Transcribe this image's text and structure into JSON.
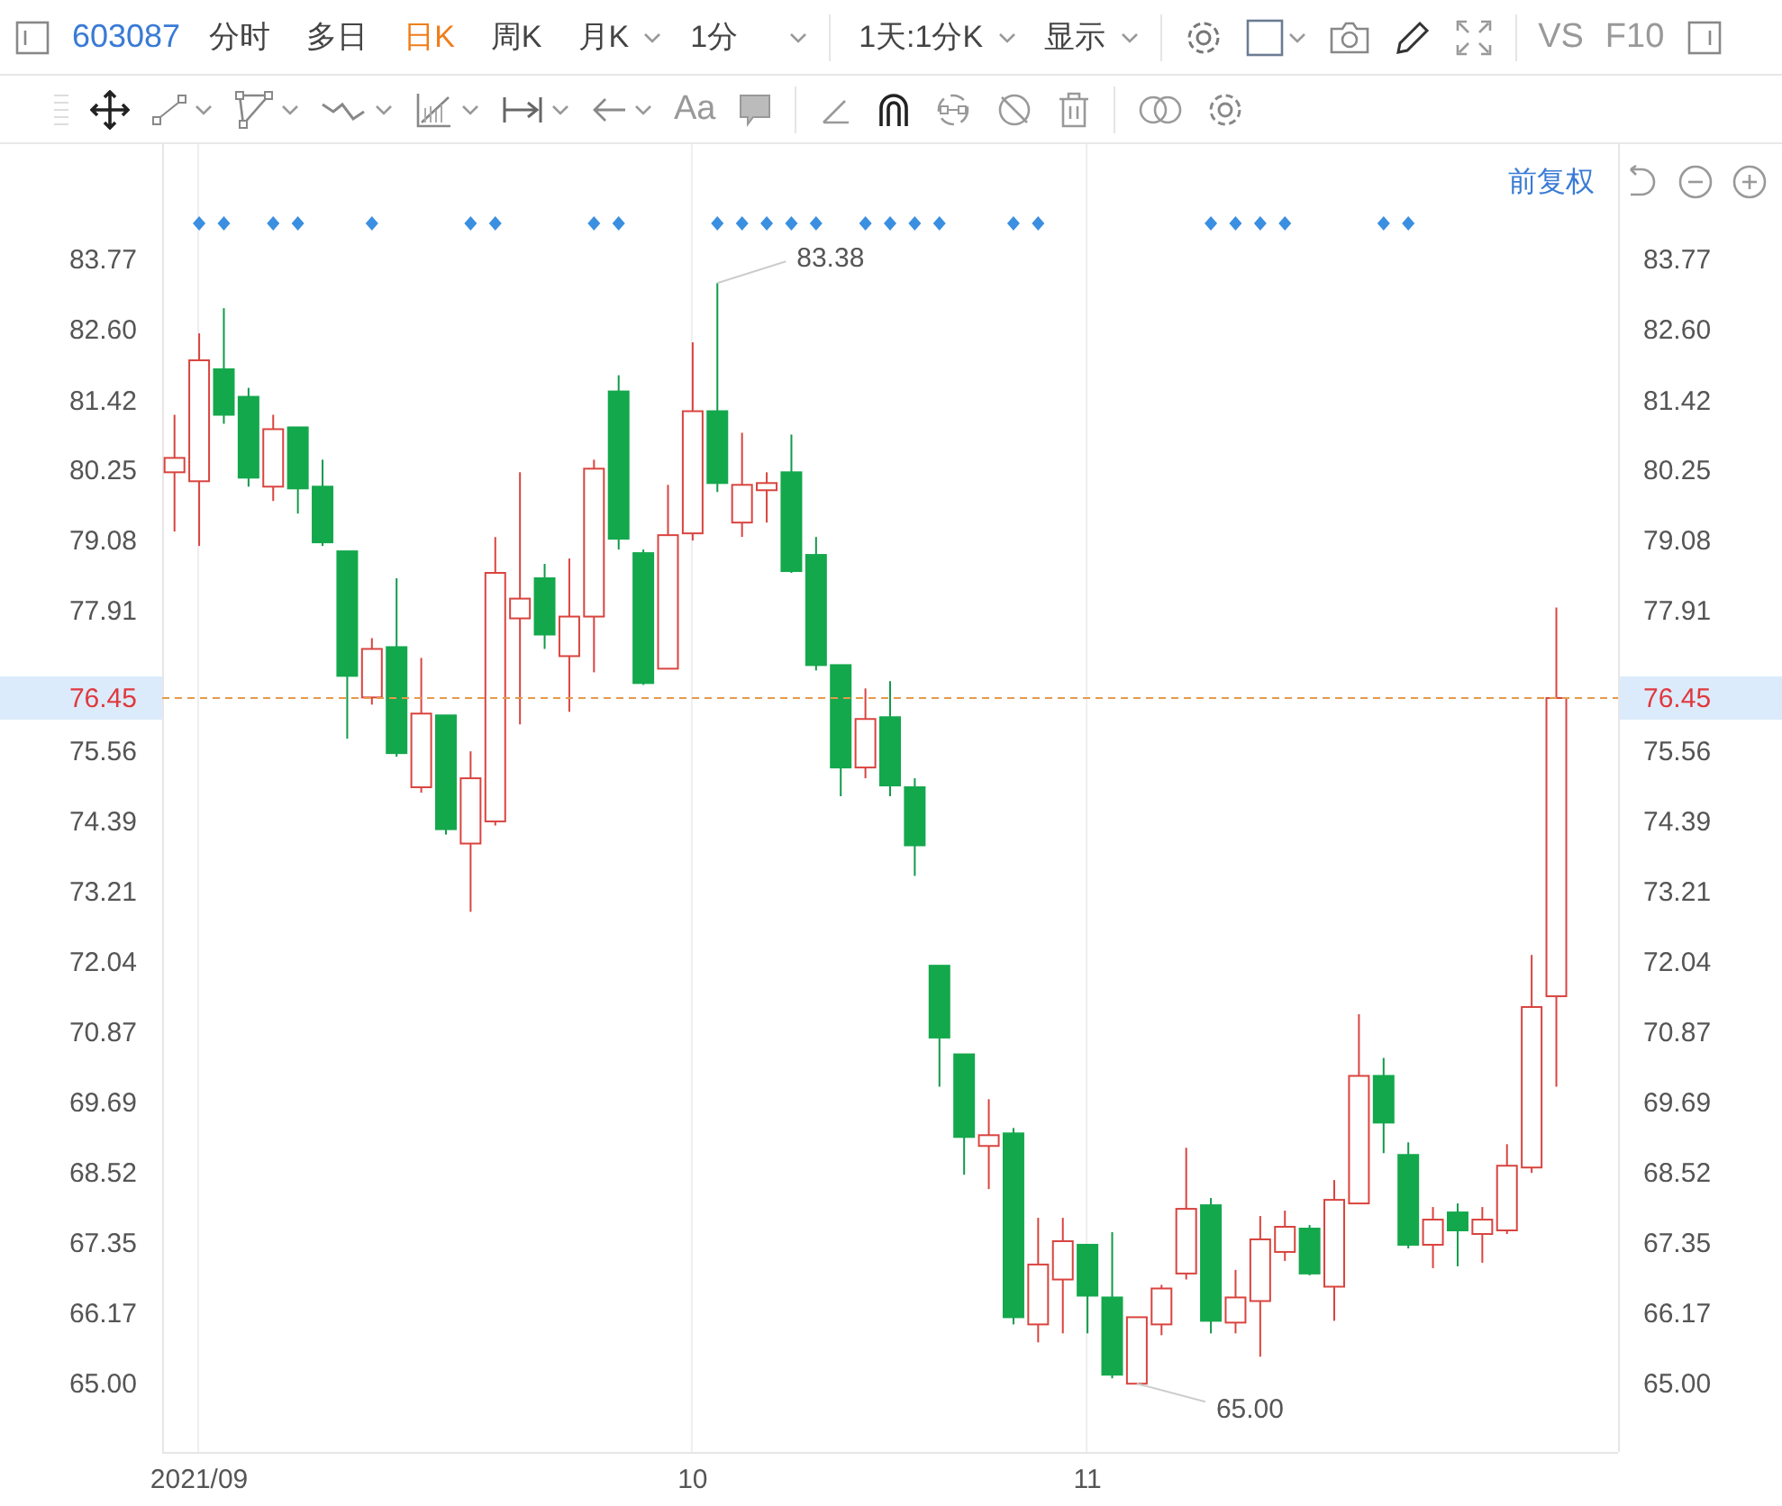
{
  "toolbar": {
    "symbol": "603087",
    "periods": [
      {
        "label": "分时",
        "selected": false,
        "dropdown": false
      },
      {
        "label": "多日",
        "selected": false,
        "dropdown": false
      },
      {
        "label": "日K",
        "selected": true,
        "dropdown": false
      },
      {
        "label": "周K",
        "selected": false,
        "dropdown": false
      },
      {
        "label": "月K",
        "selected": false,
        "dropdown": true
      },
      {
        "label": "1分",
        "selected": false,
        "dropdown": true
      }
    ],
    "range": "1天:1分K",
    "display": "显示",
    "compare": "VS",
    "f10": "F10"
  },
  "drawing_toolbar": {
    "text_tool": "Aa"
  },
  "chart": {
    "adjust": "前复权",
    "chart_data": {
      "type": "candlestick",
      "ylim": [
        63.86,
        85.7
      ],
      "yticks": [
        {
          "value": 83.77,
          "label": "83.77"
        },
        {
          "value": 82.6,
          "label": "82.60"
        },
        {
          "value": 81.42,
          "label": "81.42"
        },
        {
          "value": 80.25,
          "label": "80.25"
        },
        {
          "value": 79.08,
          "label": "79.08"
        },
        {
          "value": 77.91,
          "label": "77.91"
        },
        {
          "value": 75.56,
          "label": "75.56"
        },
        {
          "value": 74.39,
          "label": "74.39"
        },
        {
          "value": 73.21,
          "label": "73.21"
        },
        {
          "value": 72.04,
          "label": "72.04"
        },
        {
          "value": 70.87,
          "label": "70.87"
        },
        {
          "value": 69.69,
          "label": "69.69"
        },
        {
          "value": 68.52,
          "label": "68.52"
        },
        {
          "value": 67.35,
          "label": "67.35"
        },
        {
          "value": 66.17,
          "label": "66.17"
        },
        {
          "value": 65.0,
          "label": "65.00"
        }
      ],
      "categories": [
        null,
        "2021/09",
        null,
        null,
        null,
        null,
        null,
        null,
        null,
        null,
        null,
        null,
        null,
        null,
        null,
        null,
        null,
        null,
        null,
        null,
        null,
        "10",
        null,
        null,
        null,
        null,
        null,
        null,
        null,
        null,
        null,
        null,
        null,
        null,
        null,
        null,
        null,
        "11",
        null,
        null,
        null,
        null,
        null,
        null,
        null,
        null,
        null,
        null,
        null,
        null,
        null,
        null,
        null,
        null,
        null,
        null,
        null,
        null,
        null
      ],
      "ohlc": [
        [
          80.22,
          81.18,
          79.23,
          80.46
        ],
        [
          80.07,
          82.54,
          78.99,
          82.09
        ],
        [
          81.94,
          82.96,
          81.03,
          81.18
        ],
        [
          81.48,
          81.63,
          79.98,
          80.13
        ],
        [
          79.98,
          81.18,
          79.74,
          80.94
        ],
        [
          80.97,
          80.97,
          79.53,
          79.95
        ],
        [
          79.98,
          80.43,
          78.99,
          79.05
        ],
        [
          78.9,
          78.9,
          75.77,
          76.82
        ],
        [
          76.46,
          77.45,
          76.34,
          77.27
        ],
        [
          77.3,
          78.45,
          75.47,
          75.53
        ],
        [
          74.96,
          77.12,
          74.87,
          76.19
        ],
        [
          76.16,
          76.16,
          74.17,
          74.26
        ],
        [
          74.02,
          75.56,
          72.88,
          75.11
        ],
        [
          74.39,
          79.14,
          74.32,
          78.54
        ],
        [
          77.78,
          80.22,
          76.01,
          78.11
        ],
        [
          78.45,
          78.69,
          77.27,
          77.51
        ],
        [
          77.15,
          78.78,
          76.22,
          77.81
        ],
        [
          77.81,
          80.43,
          76.88,
          80.28
        ],
        [
          81.57,
          81.84,
          78.93,
          79.11
        ],
        [
          78.87,
          78.93,
          76.67,
          76.7
        ],
        [
          76.94,
          80.01,
          76.94,
          79.17
        ],
        [
          79.2,
          82.39,
          79.08,
          81.24
        ],
        [
          81.24,
          83.38,
          79.89,
          80.04
        ],
        [
          79.38,
          80.88,
          79.14,
          80.01
        ],
        [
          79.92,
          80.22,
          79.38,
          80.04
        ],
        [
          80.22,
          80.85,
          78.54,
          78.57
        ],
        [
          78.84,
          79.14,
          76.91,
          77.0
        ],
        [
          77.0,
          77.0,
          74.81,
          75.29
        ],
        [
          75.29,
          76.61,
          75.11,
          76.1
        ],
        [
          76.13,
          76.73,
          74.81,
          74.99
        ],
        [
          74.96,
          75.11,
          73.48,
          73.99
        ],
        [
          71.98,
          71.98,
          69.96,
          70.78
        ],
        [
          70.5,
          70.5,
          68.49,
          69.12
        ],
        [
          68.97,
          69.75,
          68.25,
          69.15
        ],
        [
          69.18,
          69.27,
          65.99,
          66.11
        ],
        [
          65.99,
          67.77,
          65.69,
          66.99
        ],
        [
          66.74,
          67.77,
          65.84,
          67.38
        ],
        [
          67.32,
          67.32,
          65.84,
          66.47
        ],
        [
          66.44,
          67.53,
          65.09,
          65.15
        ],
        [
          65.0,
          66.11,
          65.0,
          66.11
        ],
        [
          65.99,
          66.65,
          65.81,
          66.59
        ],
        [
          66.84,
          68.94,
          66.74,
          67.92
        ],
        [
          67.98,
          68.1,
          65.84,
          66.05
        ],
        [
          66.02,
          66.9,
          65.84,
          66.44
        ],
        [
          66.38,
          67.8,
          65.45,
          67.41
        ],
        [
          67.2,
          67.89,
          67.05,
          67.62
        ],
        [
          67.59,
          67.65,
          66.81,
          66.84
        ],
        [
          66.62,
          68.4,
          66.05,
          68.07
        ],
        [
          68.01,
          71.17,
          68.01,
          70.14
        ],
        [
          70.14,
          70.44,
          68.85,
          69.36
        ],
        [
          68.82,
          69.03,
          67.26,
          67.32
        ],
        [
          67.32,
          67.95,
          66.93,
          67.74
        ],
        [
          67.86,
          68.01,
          66.96,
          67.56
        ],
        [
          67.5,
          67.95,
          67.02,
          67.74
        ],
        [
          67.56,
          69.0,
          67.5,
          68.64
        ],
        [
          68.61,
          72.16,
          68.52,
          71.29
        ],
        [
          71.47,
          77.96,
          69.96,
          76.45
        ],
        null,
        null
      ],
      "grid": "x",
      "ref_lines": [
        {
          "axis": "y",
          "value": 76.45,
          "label": "76.45"
        }
      ],
      "annotations": [
        "83.38",
        "65.00"
      ]
    },
    "event_flags": [
      false,
      true,
      true,
      false,
      true,
      true,
      false,
      false,
      true,
      false,
      false,
      false,
      true,
      true,
      false,
      false,
      false,
      true,
      true,
      false,
      false,
      false,
      true,
      true,
      true,
      true,
      true,
      false,
      true,
      true,
      true,
      true,
      false,
      false,
      true,
      true,
      false,
      false,
      false,
      false,
      false,
      false,
      true,
      true,
      true,
      true,
      false,
      false,
      false,
      true,
      true,
      false,
      false,
      false,
      false,
      false,
      false
    ]
  }
}
